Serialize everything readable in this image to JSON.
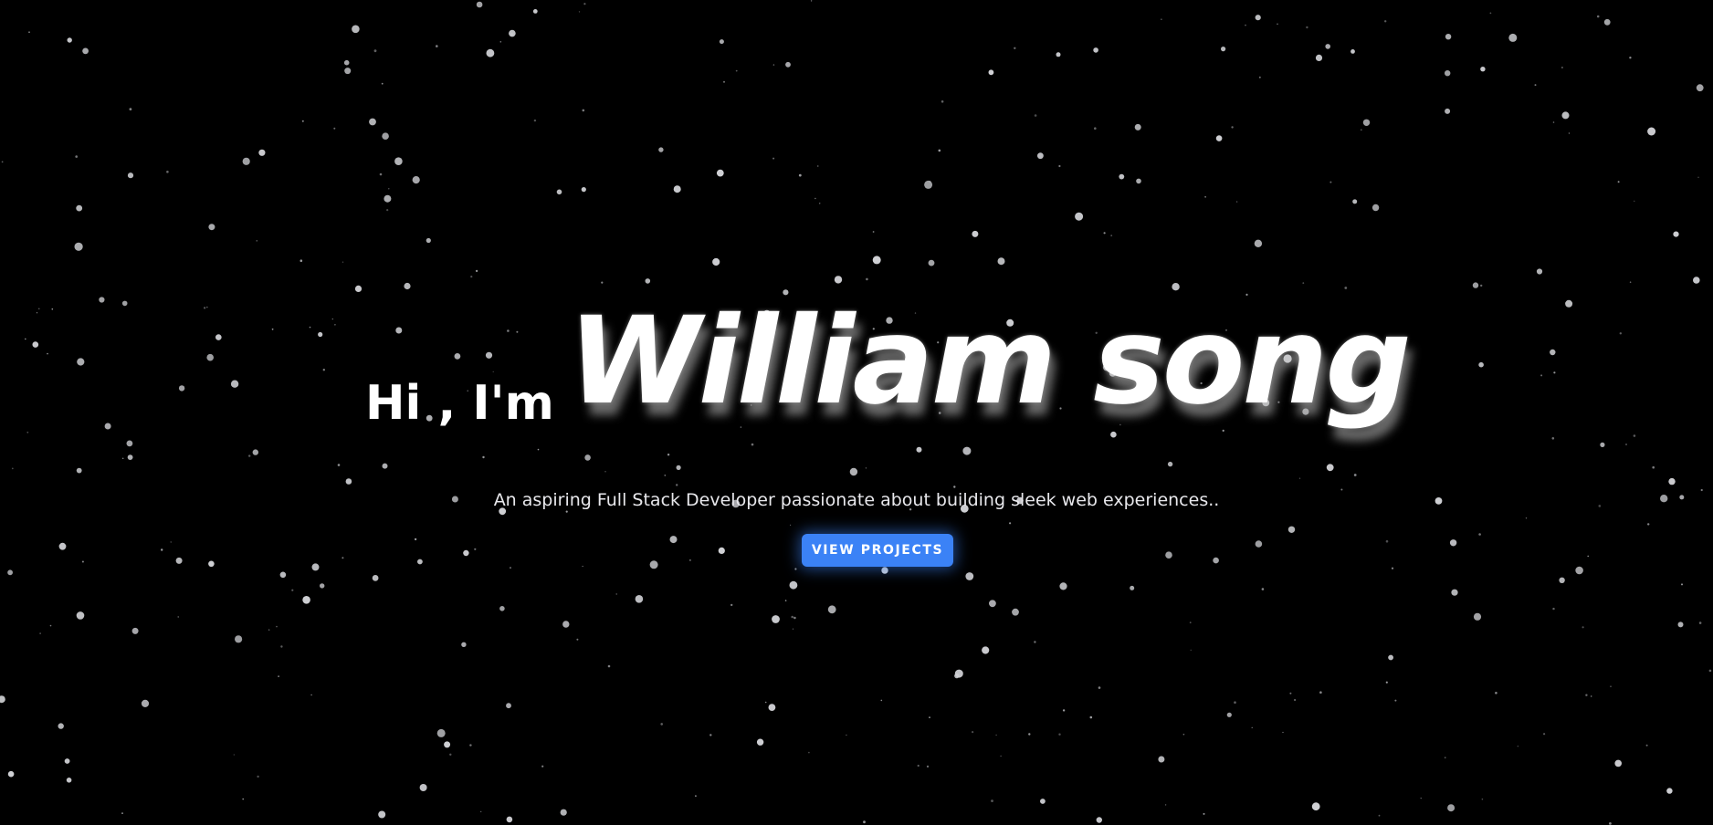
{
  "hero": {
    "greeting": "Hi , I'm",
    "name": "William  song",
    "tagline": "An aspiring Full Stack Developer passionate about building sleek web experiences..",
    "cta_label": "VIEW PROJECTS"
  },
  "colors": {
    "background": "#000000",
    "text": "#ffffff",
    "star": "#cfd0d4",
    "accent": "#3b82f6"
  }
}
